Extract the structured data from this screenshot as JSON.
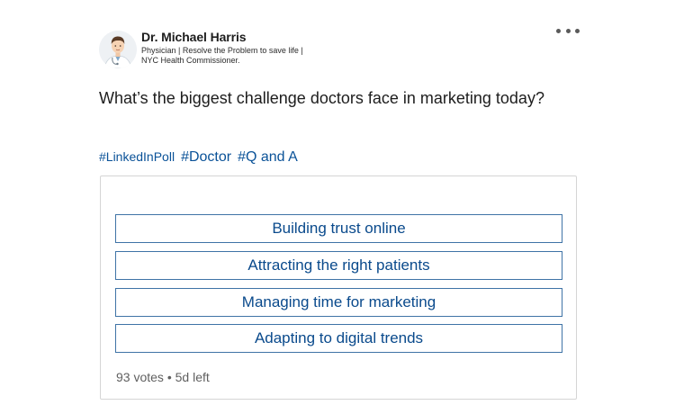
{
  "author": {
    "name": "Dr. Michael Harris",
    "headline_line1": "Physician | Resolve the Problem to save life |",
    "headline_line2": "NYC Health Commissioner."
  },
  "menu": {
    "icon": "more-horizontal-icon"
  },
  "post": {
    "question": "What’s the biggest challenge doctors face in marketing today?",
    "hashtags": [
      "#LinkedInPoll",
      "#Doctor",
      "#Q and A"
    ]
  },
  "poll": {
    "options": [
      "Building trust online",
      "Attracting the right patients",
      "Managing time for marketing",
      "Adapting to digital trends"
    ],
    "votes": "93 votes",
    "separator": "•",
    "time_left": "5d left"
  },
  "colors": {
    "link": "#0a5298",
    "option_border": "#3f73a6",
    "option_text": "#0a4a8c",
    "text": "#1d1d1d",
    "muted": "#5f5f5f"
  }
}
